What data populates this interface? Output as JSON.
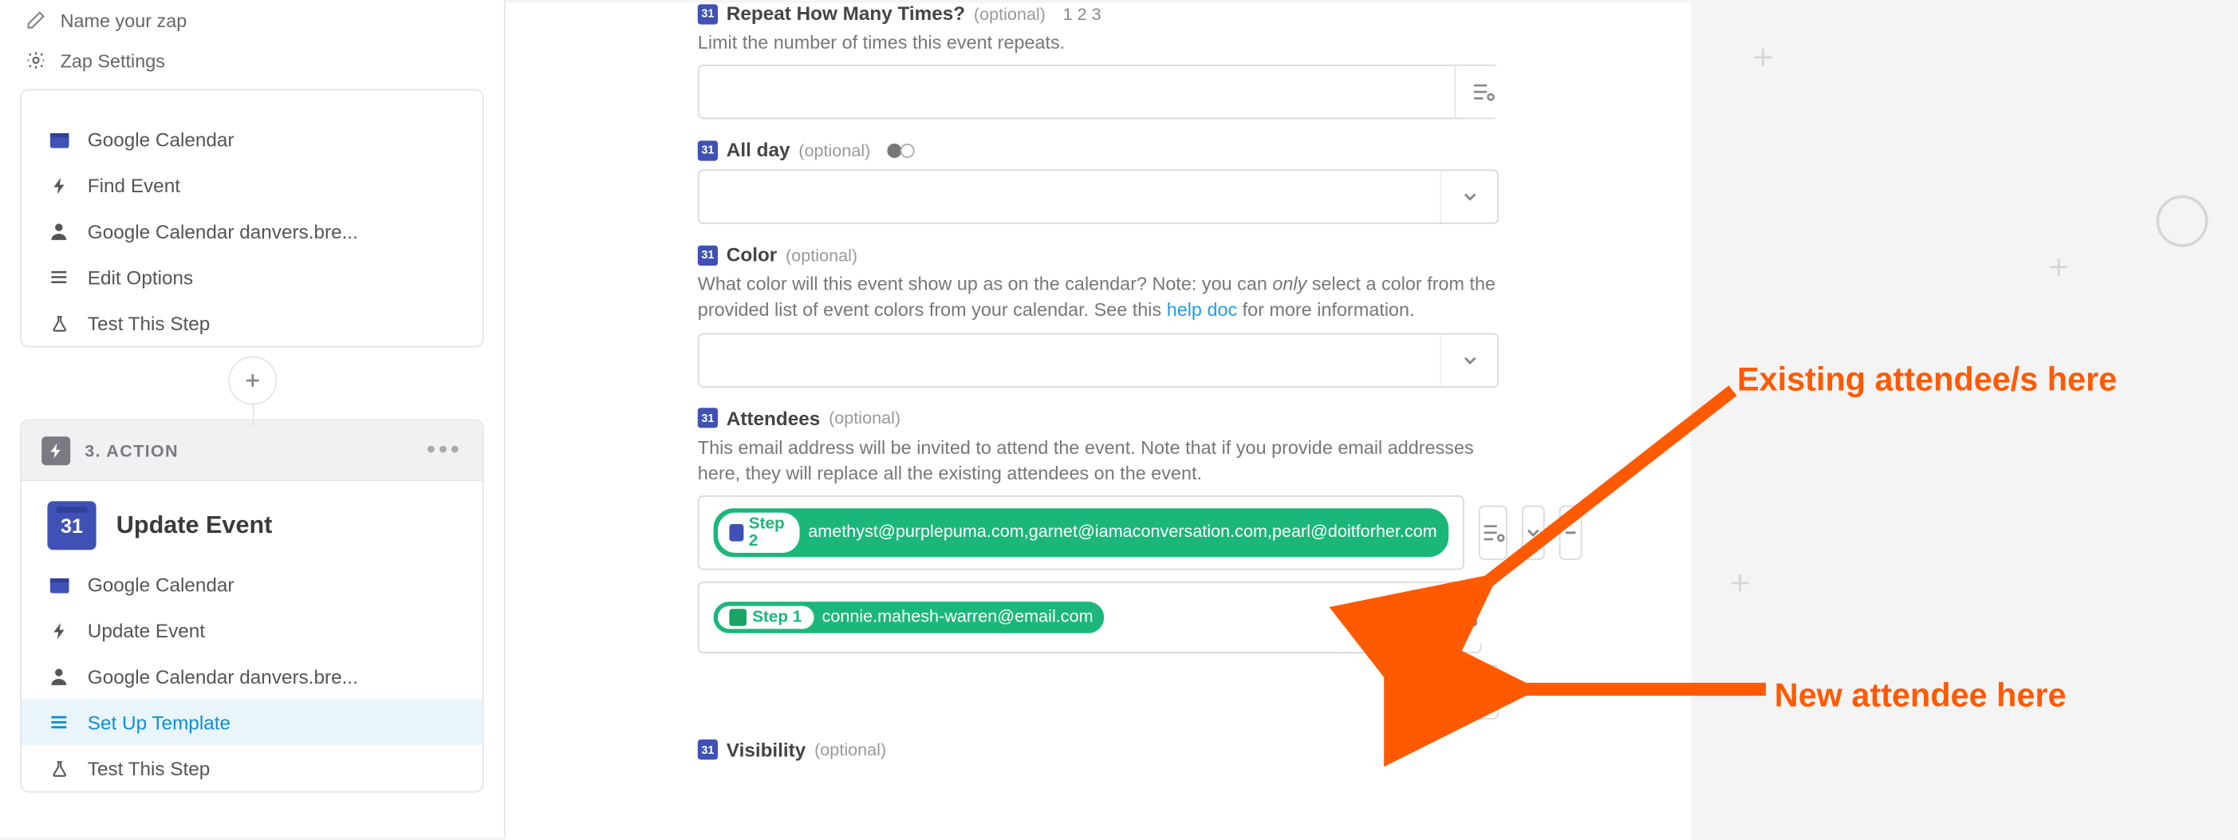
{
  "header": {
    "name_placeholder": "Name your zap",
    "settings_label": "Zap Settings"
  },
  "panel1": {
    "clipped_app": "Find Event",
    "rows": [
      {
        "icon": "cal",
        "label": "Google Calendar"
      },
      {
        "icon": "bolt",
        "label": "Find Event"
      },
      {
        "icon": "user",
        "label": "Google Calendar danvers.bre..."
      },
      {
        "icon": "lines",
        "label": "Edit Options"
      },
      {
        "icon": "flask",
        "label": "Test This Step"
      }
    ]
  },
  "panel2": {
    "step_label": "3. ACTION",
    "app_title": "Update Event",
    "cal_number": "31",
    "rows": [
      {
        "icon": "cal",
        "label": "Google Calendar",
        "active": false
      },
      {
        "icon": "bolt",
        "label": "Update Event",
        "active": false
      },
      {
        "icon": "user",
        "label": "Google Calendar danvers.bre...",
        "active": false
      },
      {
        "icon": "lines",
        "label": "Set Up Template",
        "active": true
      },
      {
        "icon": "flask",
        "label": "Test This Step",
        "active": false
      }
    ]
  },
  "form": {
    "repeat": {
      "label": "Repeat How Many Times?",
      "optional": "(optional)",
      "extra": "1 2 3",
      "help": "Limit the number of times this event repeats."
    },
    "allday": {
      "label": "All day",
      "optional": "(optional)"
    },
    "color": {
      "label": "Color",
      "optional": "(optional)",
      "help_pre": "What color will this event show up as on the calendar? Note: you can ",
      "help_em": "only",
      "help_mid": " select a color from the provided list of event colors from your calendar. See this ",
      "help_link": "help doc",
      "help_post": " for more information."
    },
    "attendees": {
      "label": "Attendees",
      "optional": "(optional)",
      "help": "This email address will be invited to attend the event. Note that if you provide email addresses here, they will replace all the existing attendees on the event.",
      "row1_step": "Step 2",
      "row1_val": "amethyst@purplepuma.com,garnet@iamaconversation.com,pearl@doitforher.com",
      "row2_step": "Step 1",
      "row2_val": "connie.mahesh-warren@email.com"
    },
    "visibility": {
      "label": "Visibility",
      "optional": "(optional)"
    }
  },
  "annotations": {
    "existing": "Existing attendee/s here",
    "new": "New attendee here"
  }
}
